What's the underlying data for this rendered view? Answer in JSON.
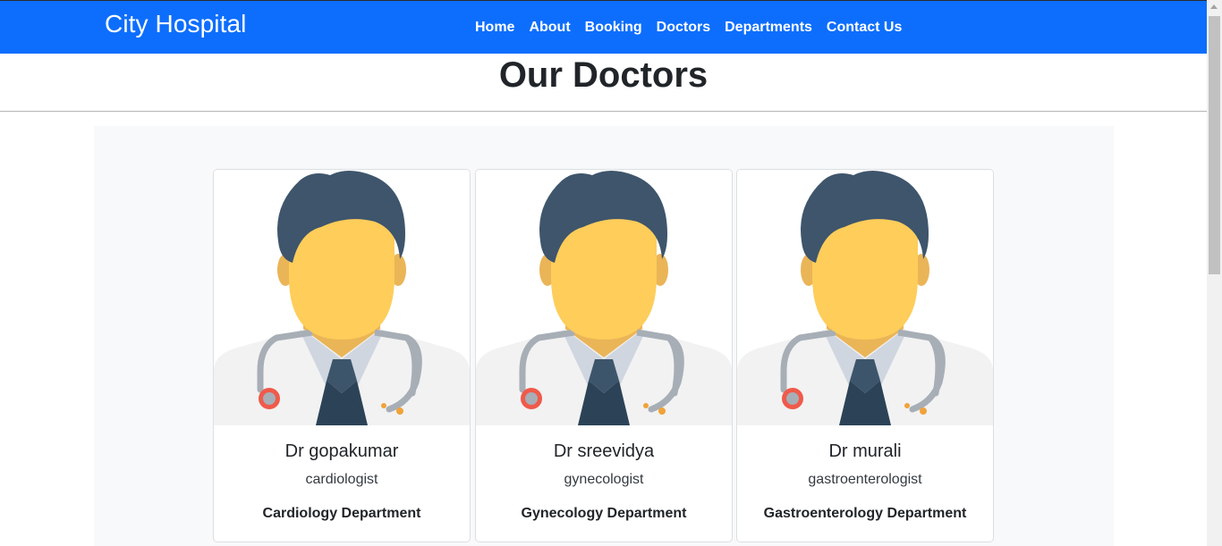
{
  "navbar": {
    "brand": "City Hospital",
    "links": [
      "Home",
      "About",
      "Booking",
      "Doctors",
      "Departments",
      "Contact Us"
    ],
    "background": "#0d6efd"
  },
  "page": {
    "title": "Our Doctors"
  },
  "doctors": [
    {
      "name": "Dr gopakumar",
      "specialty": "cardiologist",
      "department": "Cardiology Department",
      "avatar_icon": "doctor-avatar-icon"
    },
    {
      "name": "Dr sreevidya",
      "specialty": "gynecologist",
      "department": "Gynecology Department",
      "avatar_icon": "doctor-avatar-icon"
    },
    {
      "name": "Dr murali",
      "specialty": "gastroenterologist",
      "department": "Gastroenterology Department",
      "avatar_icon": "doctor-avatar-icon"
    }
  ]
}
